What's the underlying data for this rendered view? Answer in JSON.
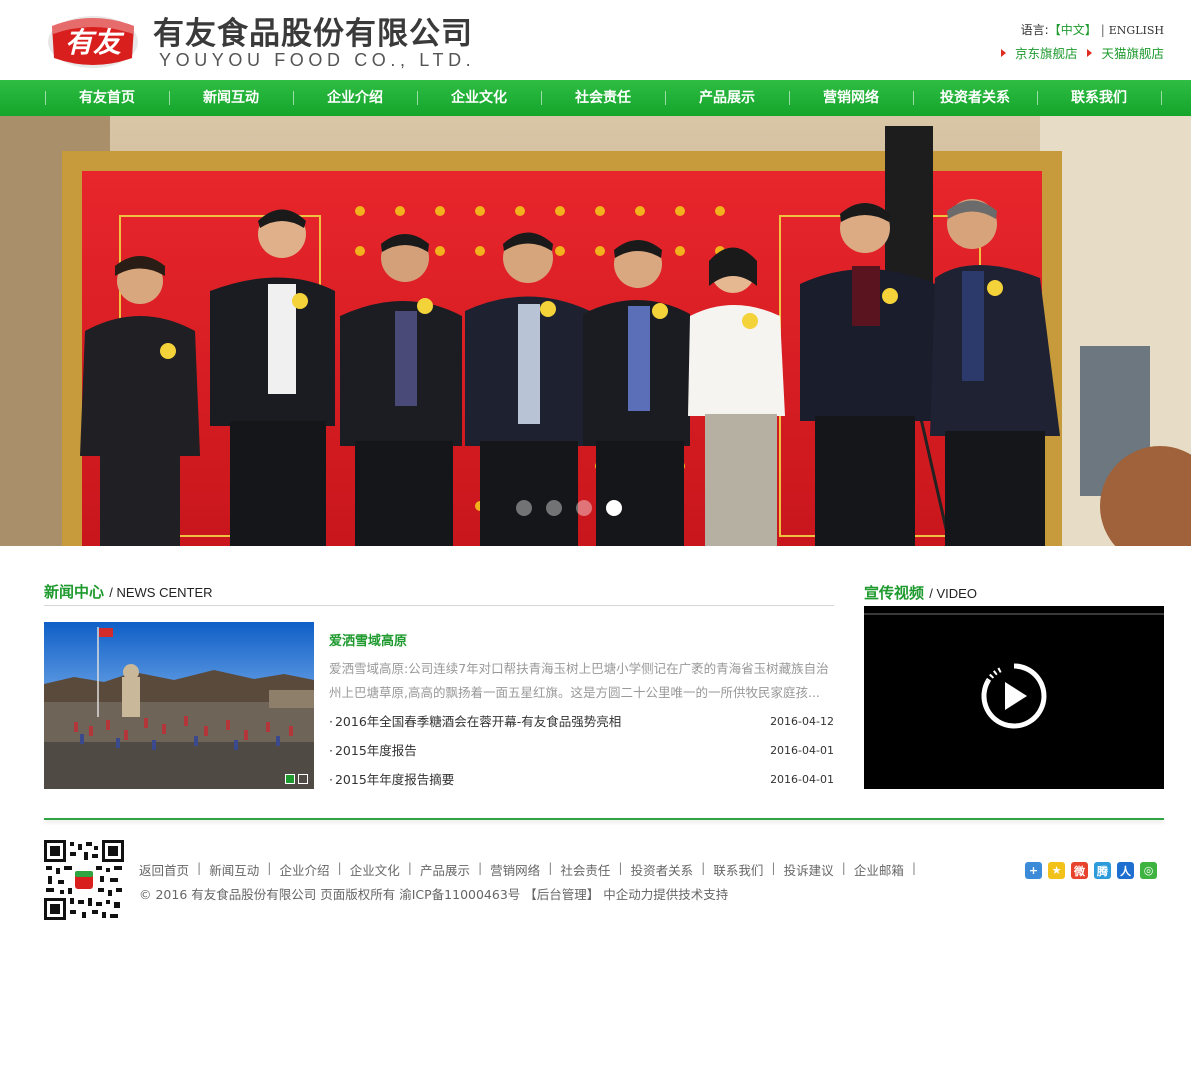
{
  "header": {
    "logo_mark": "有友",
    "company_cn": "有友食品股份有限公司",
    "company_en": "YOUYOU FOOD CO., LTD.",
    "lang_label": "语言:",
    "lang_current": "【中文】",
    "lang_sep": "|",
    "lang_en": "ENGLISH",
    "shop_jd": "京东旗舰店",
    "shop_tmall": "天猫旗舰店"
  },
  "nav": {
    "items": [
      {
        "label": "有友首页"
      },
      {
        "label": "新闻互动"
      },
      {
        "label": "企业介绍"
      },
      {
        "label": "企业文化"
      },
      {
        "label": "社会责任"
      },
      {
        "label": "产品展示"
      },
      {
        "label": "营销网络"
      },
      {
        "label": "投资者关系"
      },
      {
        "label": "联系我们"
      }
    ]
  },
  "banner": {
    "slide_count": 4,
    "active_slide": 4
  },
  "news": {
    "title": "新闻中心",
    "subtitle": "/ NEWS CENTER",
    "featured_title": "爱洒雪域高原",
    "featured_desc": "爱洒雪域高原:公司连续7年对口帮扶青海玉树上巴塘小学侧记在广袤的青海省玉树藏族自治州上巴塘草原,高高的飘扬着一面五星红旗。这是方圆二十公里唯一的一所供牧民家庭孩...",
    "photo_pages": 2,
    "photo_active": 1,
    "items": [
      {
        "bullet": "·",
        "title": "2016年全国春季糖酒会在蓉开幕-有友食品强势亮相",
        "date": "2016-04-12"
      },
      {
        "bullet": "·",
        "title": "2015年度报告",
        "date": "2016-04-01"
      },
      {
        "bullet": "·",
        "title": "2015年年度报告摘要",
        "date": "2016-04-01"
      }
    ]
  },
  "video": {
    "title": "宣传视频",
    "subtitle": "/ VIDEO"
  },
  "footer": {
    "links": [
      "返回首页",
      "新闻互动",
      "企业介绍",
      "企业文化",
      "产品展示",
      "营销网络",
      "社会责任",
      "投资者关系",
      "联系我们",
      "投诉建议",
      "企业邮箱"
    ],
    "link_sep": "|",
    "copyright": "© 2016 有友食品股份有限公司 页面版权所有 渝ICP备11000463号 【后台管理】 中企动力提供技术支持",
    "share_icons": [
      "share-more-icon",
      "qzone-icon",
      "weibo-icon",
      "tencent-weibo-icon",
      "renren-icon",
      "wechat-icon"
    ]
  },
  "colors": {
    "brand_green": "#1f9a2f",
    "nav_green": "#22b038",
    "accent_red": "#e02b20"
  }
}
